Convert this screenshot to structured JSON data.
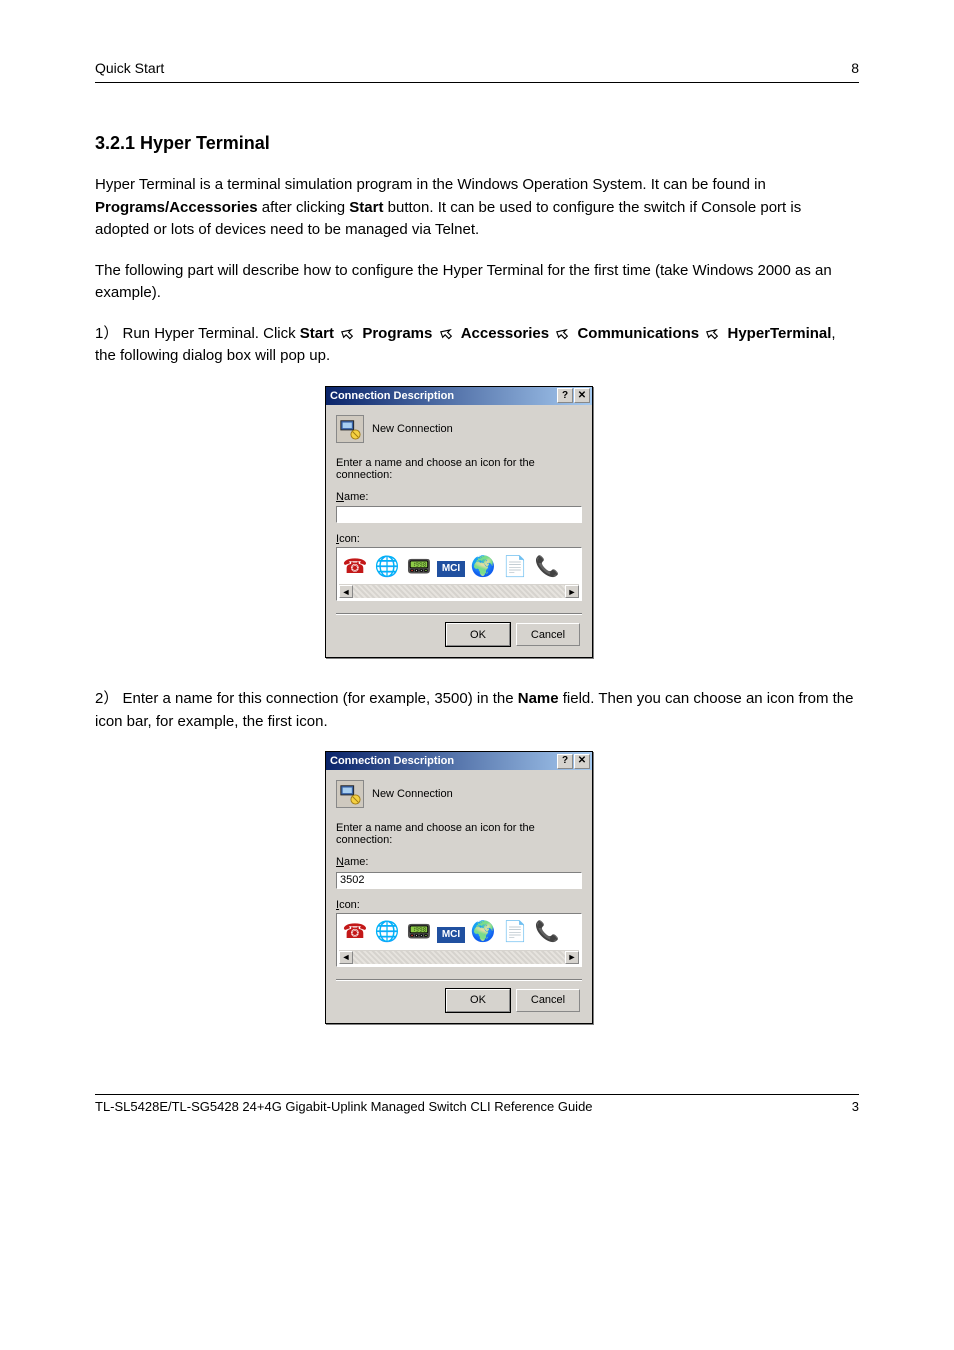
{
  "header": {
    "left": "Quick Start",
    "right": "8"
  },
  "section_title": "3.2.1 Hyper Terminal",
  "p1_a": "Hyper Terminal is a terminal simulation program in the Windows Operation System. It can be found in ",
  "p1_b": "Programs/Accessories",
  "p1_c": " after clicking ",
  "p1_d": "Start",
  "p1_e": " button. It can be used to configure the switch if Console port is adopted or lots of devices need to be managed via Telnet.",
  "p2": "The following part will describe how to configure the Hyper Terminal for the first time (take Windows 2000 as an example).",
  "step1_a": "1） Run Hyper Terminal. Click ",
  "step1_b": "Start",
  "step1_c": "Programs",
  "step1_d": "Accessories",
  "step1_e": "Communications",
  "step1_f": "HyperTerminal",
  "step1_g": ", the following dialog box will pop up.",
  "step2_a": "2） Enter a name for this connection (for example, 3500) in the ",
  "step2_b": "Name",
  "step2_c": " field. Then you can choose an icon from the icon bar, for example, the first icon.",
  "dialog": {
    "title": "Connection Description",
    "newconn": "New Connection",
    "instr": "Enter a name and choose an icon for the connection:",
    "name_label_u": "N",
    "name_label_rest": "ame:",
    "icon_label_u": "I",
    "icon_label_rest": "con:",
    "ok": "OK",
    "cancel": "Cancel",
    "value1": "",
    "value2": "3502",
    "mci": "MCI"
  },
  "footer": {
    "left": "TL-SL5428E/TL-SG5428 24+4G Gigabit-Uplink Managed Switch CLI Reference Guide",
    "right": "3"
  }
}
